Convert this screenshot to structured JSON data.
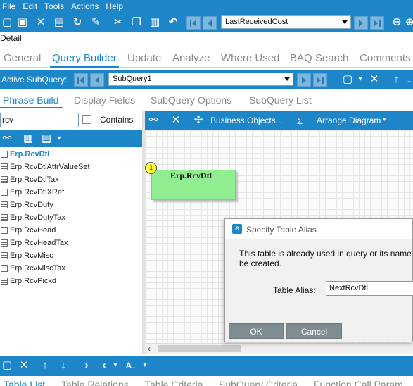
{
  "menu": [
    "File",
    "Edit",
    "Tools",
    "Actions",
    "Help"
  ],
  "toolbar": {
    "record_combo_value": "LastReceivedCost"
  },
  "detail_label": "Detail",
  "main_tabs": [
    "General",
    "Query Builder",
    "Update",
    "Analyze",
    "Where Used",
    "BAQ Search",
    "Comments"
  ],
  "main_tabs_active": "Query Builder",
  "subquery_bar": {
    "label": "Active SubQuery:",
    "combo_value": "SubQuery1"
  },
  "sub_tabs": [
    "Phrase Build",
    "Display Fields",
    "SubQuery Options",
    "SubQuery List"
  ],
  "left_panel": {
    "search_value": "rcv",
    "contains_label": "Contains",
    "contains_checked": false,
    "tables": [
      "Erp.RcvDtl",
      "Erp.RcvDtlAttrValueSet",
      "Erp.RcvDtlTax",
      "Erp.RcvDtlXRef",
      "Erp.RcvDuty",
      "Erp.RcvDutyTax",
      "Erp.RcvHead",
      "Erp.RcvHeadTax",
      "Erp.RcvMisc",
      "Erp.RcvMiscTax",
      "Erp.RcvPickd"
    ],
    "selected_table": "Erp.RcvDtl"
  },
  "canvas_toolbar": {
    "business_objects": "Business Objects...",
    "sigma": "Σ",
    "arrange_diagram": "Arrange Diagram"
  },
  "diagram": {
    "node_badge": "1",
    "node_title": "Erp.RcvDtl",
    "node_color": "#90ee90"
  },
  "dialog": {
    "title": "Specify Table Alias",
    "message": "This table is already used in query or its name be created.",
    "alias_label": "Table Alias:",
    "alias_value": "NextRcvDtl",
    "ok_label": "OK",
    "cancel_label": "Cancel"
  },
  "bottom_tabs": [
    "Table List",
    "Table Relations",
    "Table Criteria",
    "SubQuery Criteria",
    "Function Call Param"
  ],
  "colors": {
    "accent": "#1d86c9",
    "node_green": "#90ee90",
    "badge_yellow": "#ffff33"
  }
}
